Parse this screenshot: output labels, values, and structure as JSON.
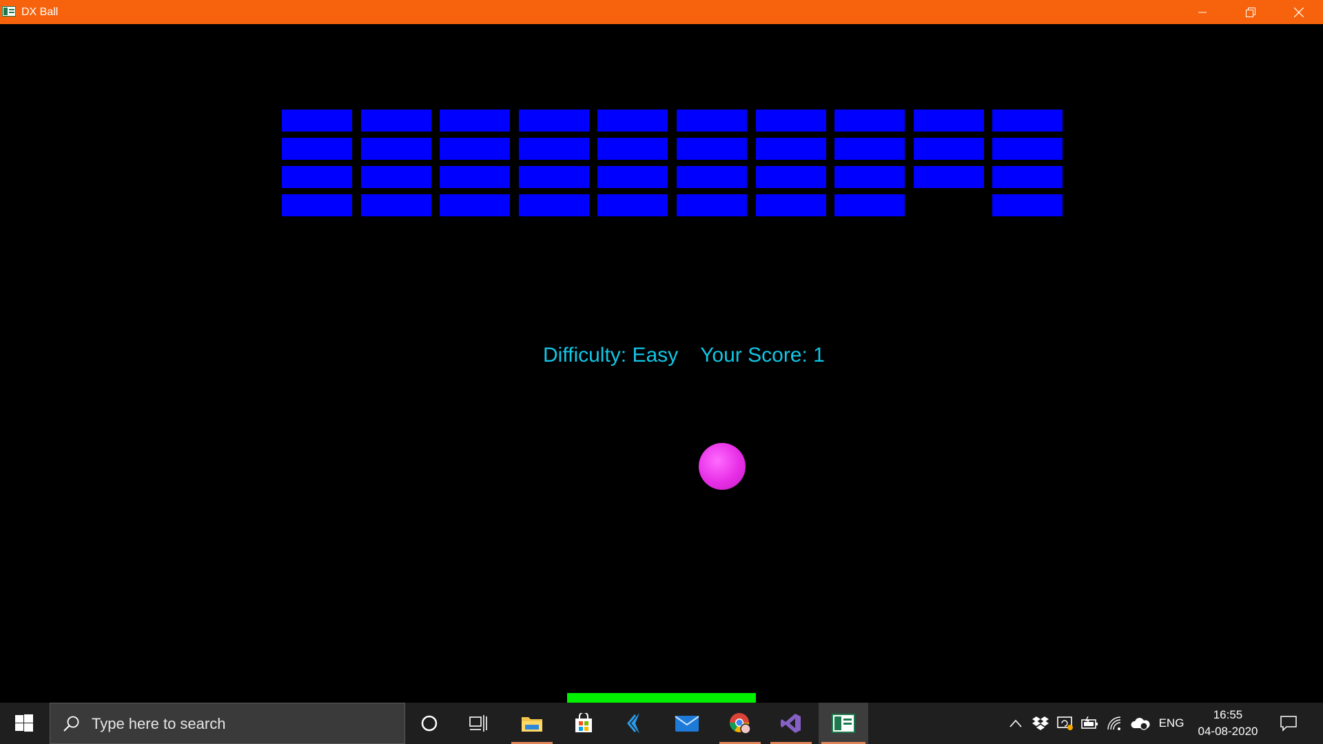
{
  "window": {
    "title": "DX Ball",
    "controls": {
      "minimize": "minimize-icon",
      "restore": "restore-icon",
      "close": "close-icon"
    },
    "titlebar_color": "#f7630c"
  },
  "game": {
    "background": "#000000",
    "brick_color": "#0000ff",
    "brick_rows": [
      [
        true,
        true,
        true,
        true,
        true,
        true,
        true,
        true,
        true,
        true
      ],
      [
        true,
        true,
        true,
        true,
        true,
        true,
        true,
        true,
        true,
        true
      ],
      [
        true,
        true,
        true,
        true,
        true,
        true,
        true,
        true,
        true,
        true
      ],
      [
        true,
        true,
        true,
        true,
        true,
        true,
        true,
        true,
        false,
        true
      ]
    ],
    "hud": {
      "difficulty": "Difficulty: Easy",
      "score": "Your Score: 1",
      "color": "#11c6e6"
    },
    "ball_color": "#e72ee6",
    "paddle_color": "#00f000"
  },
  "taskbar": {
    "search_placeholder": "Type here to search",
    "apps": [
      {
        "name": "file-explorer-icon",
        "active": true
      },
      {
        "name": "microsoft-store-icon",
        "active": false
      },
      {
        "name": "visual-studio-code-insiders-icon",
        "active": false
      },
      {
        "name": "mail-icon",
        "active": false
      },
      {
        "name": "chrome-icon",
        "active": true
      },
      {
        "name": "visual-studio-icon",
        "active": true
      },
      {
        "name": "dx-ball-app-icon",
        "active": true
      }
    ],
    "tray": {
      "language": "ENG",
      "time": "16:55",
      "date": "04-08-2020"
    }
  }
}
